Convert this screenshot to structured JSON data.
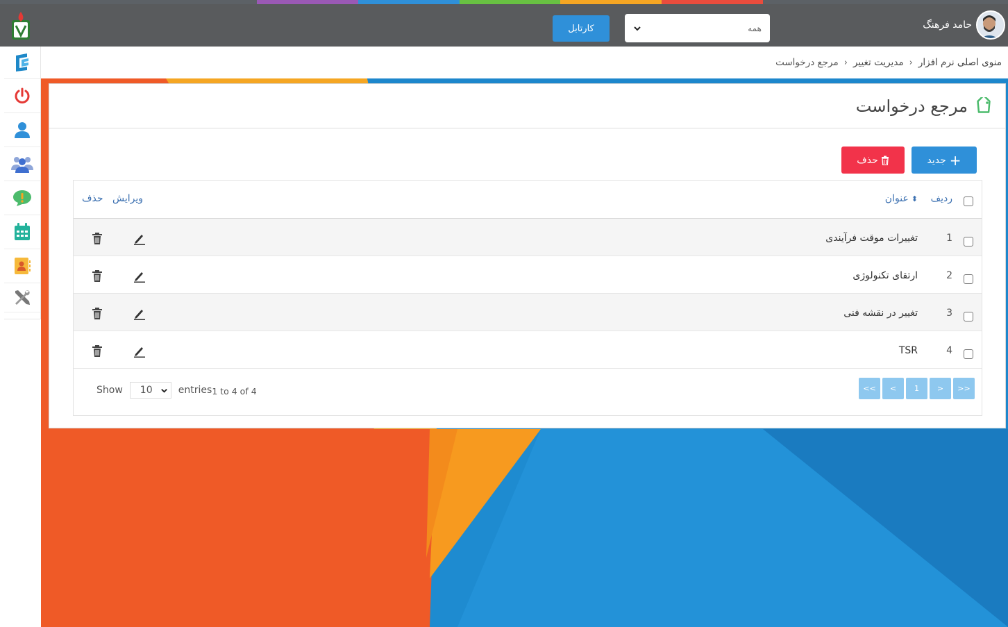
{
  "colors": {
    "topbar": "#595b5d",
    "primary": "#2f90d9",
    "danger": "#f2334a",
    "pager": "#8ec8ef",
    "stripe": [
      "#5c6166",
      "#9a59b5",
      "#2f90d9",
      "#68c142",
      "#f6a623",
      "#e94c3d",
      "#5c6166"
    ]
  },
  "header": {
    "username": "حامد فرهنگ",
    "filter_value": "همه",
    "kartabl_label": "کارتابل"
  },
  "sidebar": {
    "icons": [
      "app-logo-icon",
      "power-icon",
      "user-icon",
      "users-icon",
      "chat-alert-icon",
      "calendar-icon",
      "contact-card-icon",
      "tools-icon"
    ]
  },
  "breadcrumb": {
    "items": [
      "منوی اصلی نرم افزار",
      "مدیریت تغییر",
      "مرجع درخواست"
    ]
  },
  "panel": {
    "title": "مرجع درخواست",
    "new_label": "جدید",
    "delete_label": "حذف"
  },
  "table": {
    "headers": {
      "row": "ردیف",
      "title": "عنوان",
      "edit": "ویرایش",
      "delete": "حذف"
    },
    "rows": [
      {
        "no": "1",
        "title": "تغییرات موقت فرآیندی"
      },
      {
        "no": "2",
        "title": "ارتقای تکنولوژی"
      },
      {
        "no": "3",
        "title": "تغییر در نقشه فنی"
      },
      {
        "no": "4",
        "title": "TSR"
      }
    ]
  },
  "footer": {
    "show_label": "Show",
    "page_size": "10",
    "entries_label": "entries",
    "info": "1 to 4 of 4",
    "pager": [
      "<<",
      "<",
      "1",
      ">",
      ">>"
    ]
  }
}
